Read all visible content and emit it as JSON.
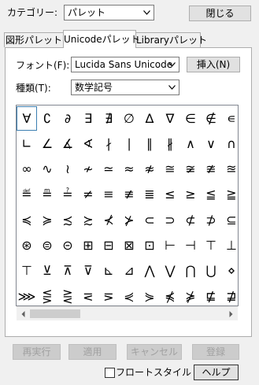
{
  "header": {
    "category_label": "カテゴリー:",
    "category_value": "パレット",
    "close_button": "閉じる"
  },
  "tabs": [
    {
      "label": "図形パレット",
      "active": false
    },
    {
      "label": "Unicodeパレット",
      "active": true
    },
    {
      "label": "Libraryパレット",
      "active": false
    }
  ],
  "font": {
    "label": "フォント(F):",
    "value": "Lucida Sans Unicode",
    "insert_button": "挿入(N)"
  },
  "kind": {
    "label": "種類(T):",
    "value": "数学記号"
  },
  "symbols": [
    [
      "∀",
      "∁",
      "∂",
      "∃",
      "∄",
      "∅",
      "∆",
      "∇",
      "∈",
      "∉",
      "∊"
    ],
    [
      "∟",
      "∠",
      "∡",
      "∢",
      "∤",
      "∣",
      "∥",
      "∦",
      "∧",
      "∨",
      "∩"
    ],
    [
      "∞",
      "∿",
      "≀",
      "≁",
      "≃",
      "≈",
      "≉",
      "≅",
      "≆",
      "≇",
      "≊"
    ],
    [
      "≝",
      "≞",
      "≟",
      "≠",
      "≡",
      "≢",
      "≣",
      "≤",
      "≥",
      "≦",
      "≧"
    ],
    [
      "≼",
      "≽",
      "≾",
      "≿",
      "⊀",
      "⊁",
      "⊂",
      "⊃",
      "⊄",
      "⊅",
      "⊆"
    ],
    [
      "⊛",
      "⊜",
      "⊝",
      "⊞",
      "⊟",
      "⊠",
      "⊡",
      "⊢",
      "⊣",
      "⊤",
      "⊥"
    ],
    [
      "⊤",
      "⊻",
      "⊼",
      "⊽",
      "⊾",
      "⊿",
      "⋀",
      "⋁",
      "⋂",
      "⋃",
      "⋄"
    ],
    [
      "⋙",
      "⋚",
      "⋛",
      "⋜",
      "⋝",
      "⋞",
      "⋟",
      "⋠",
      "⋡",
      "⋢",
      "⋣"
    ]
  ],
  "bottom_buttons": [
    "再実行",
    "適用",
    "キャンセル",
    "登録"
  ],
  "float_style_label": "フロートスタイル",
  "help_button": "ヘルプ"
}
